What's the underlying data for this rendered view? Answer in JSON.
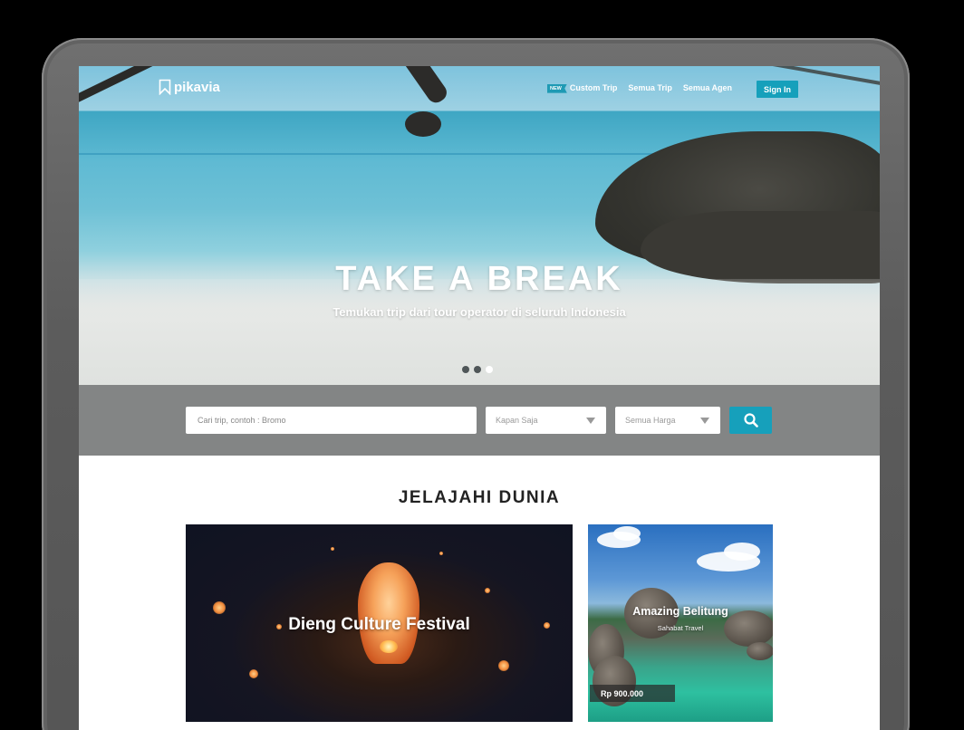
{
  "navbar": {
    "logo_text": "pikavia",
    "new_badge": "NEW",
    "links": [
      "Custom Trip",
      "Semua Trip",
      "Semua Agen"
    ],
    "signin_label": "Sign In"
  },
  "hero": {
    "title": "TAKE A BREAK",
    "subtitle": "Temukan trip dari tour operator di seluruh Indonesia",
    "slides_total": 3,
    "slide_active": 3
  },
  "search": {
    "placeholder": "Cari trip, contoh : Bromo",
    "when_value": "Kapan Saja",
    "price_value": "Semua Harga"
  },
  "explore": {
    "title": "JELAJAHI DUNIA",
    "cards": [
      {
        "title": "Dieng Culture Festival"
      },
      {
        "title": "Amazing Belitung",
        "agent": "Sahabat Travel",
        "price": "Rp 900.000"
      }
    ]
  },
  "colors": {
    "accent": "#16a0bb",
    "search_band": "#838585"
  }
}
